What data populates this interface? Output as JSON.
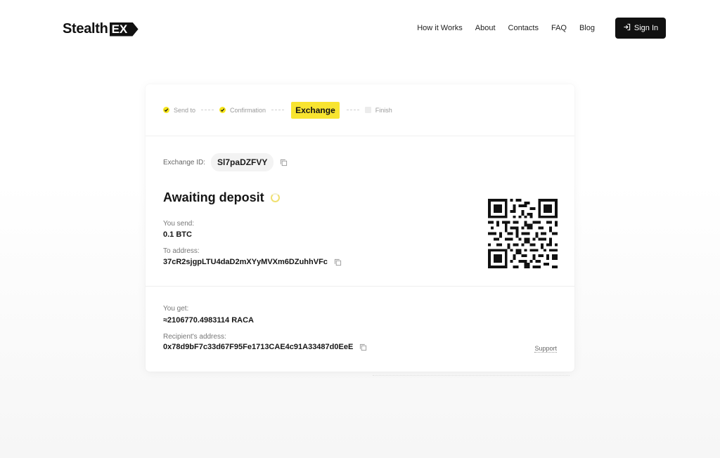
{
  "header": {
    "logo_text": "Stealth",
    "logo_badge": "EX",
    "nav": [
      "How it Works",
      "About",
      "Contacts",
      "FAQ",
      "Blog"
    ],
    "signin_label": "Sign In"
  },
  "steps": [
    {
      "label": "Send to",
      "state": "done"
    },
    {
      "label": "Confirmation",
      "state": "done"
    },
    {
      "label": "Exchange",
      "state": "active"
    },
    {
      "label": "Finish",
      "state": "pending"
    }
  ],
  "exchange": {
    "id_label": "Exchange ID:",
    "id_value": "Sl7paDZFVY",
    "status": "Awaiting deposit",
    "send_label": "You send:",
    "send_value": "0.1 BTC",
    "to_label": "To address:",
    "to_value": "37cR2sjgpLTU4daD2mXYyMVXm6DZuhhVFc",
    "get_label": "You get:",
    "get_value": "≈2106770.4983114 RACA",
    "recipient_label": "Recipient's address:",
    "recipient_value": "0x78d9bF7c33d67F95Fe1713CAE4c91A33487d0EeE",
    "support_label": "Support"
  },
  "colors": {
    "accent": "#F8E430",
    "dark": "#111111"
  }
}
